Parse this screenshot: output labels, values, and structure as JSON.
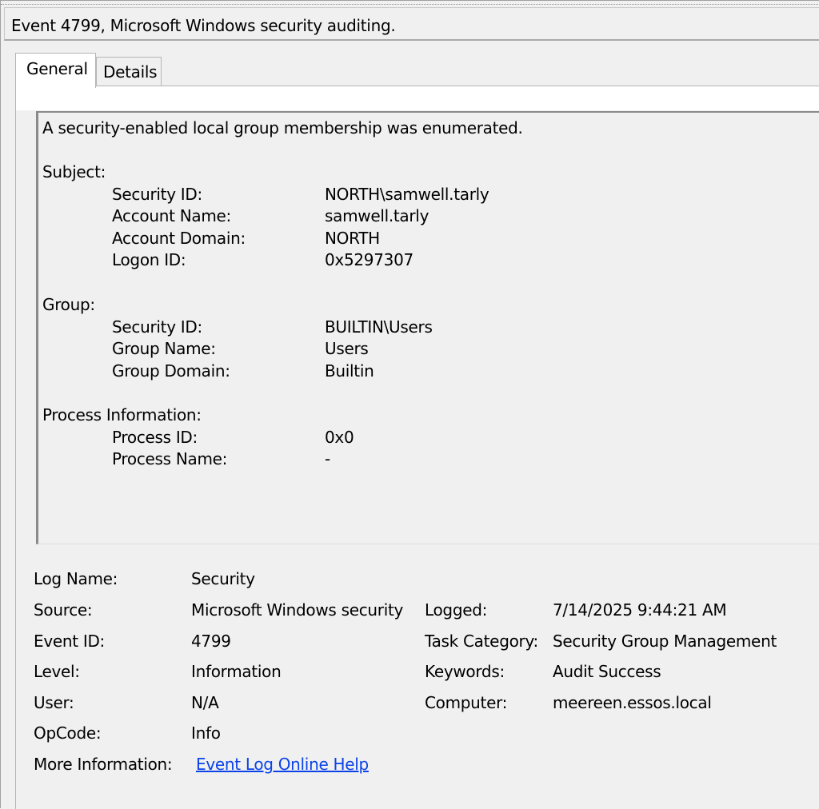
{
  "window": {
    "title": "Event 4799, Microsoft Windows security auditing."
  },
  "tabs": [
    {
      "label": "General",
      "active": true
    },
    {
      "label": "Details",
      "active": false
    }
  ],
  "description": {
    "summary": "A security-enabled local group membership was enumerated.",
    "subject": {
      "heading": "Subject:",
      "fields": [
        {
          "label": "Security ID:",
          "value": "NORTH\\samwell.tarly"
        },
        {
          "label": "Account Name:",
          "value": "samwell.tarly"
        },
        {
          "label": "Account Domain:",
          "value": "NORTH"
        },
        {
          "label": "Logon ID:",
          "value": "0x5297307"
        }
      ]
    },
    "group": {
      "heading": "Group:",
      "fields": [
        {
          "label": "Security ID:",
          "value": "BUILTIN\\Users"
        },
        {
          "label": "Group Name:",
          "value": "Users"
        },
        {
          "label": "Group Domain:",
          "value": "Builtin"
        }
      ]
    },
    "process": {
      "heading": "Process Information:",
      "fields": [
        {
          "label": "Process ID:",
          "value": "0x0"
        },
        {
          "label": "Process Name:",
          "value": "-"
        }
      ]
    }
  },
  "details": {
    "log_name": {
      "label": "Log Name:",
      "value": "Security"
    },
    "source": {
      "label": "Source:",
      "value": "Microsoft Windows security"
    },
    "event_id": {
      "label": "Event ID:",
      "value": "4799"
    },
    "level": {
      "label": "Level:",
      "value": "Information"
    },
    "user": {
      "label": "User:",
      "value": "N/A"
    },
    "opcode": {
      "label": "OpCode:",
      "value": "Info"
    },
    "more_info": {
      "label": "More Information:",
      "link": "Event Log Online Help"
    },
    "logged": {
      "label": "Logged:",
      "value": "7/14/2025 9:44:21 AM"
    },
    "task_category": {
      "label": "Task Category:",
      "value": "Security Group Management"
    },
    "keywords": {
      "label": "Keywords:",
      "value": "Audit Success"
    },
    "computer": {
      "label": "Computer:",
      "value": "meereen.essos.local"
    }
  },
  "colors": {
    "background": "#f0f0f0",
    "link": "#0b43e8",
    "border": "#8a8a8a"
  }
}
